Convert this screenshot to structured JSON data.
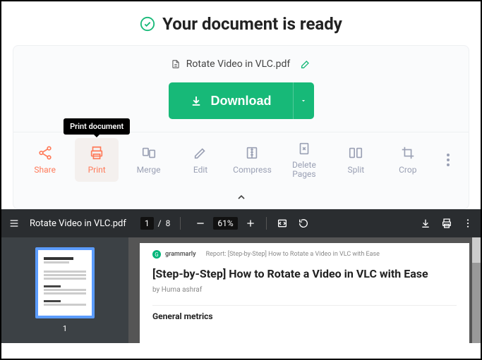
{
  "header": {
    "title": "Your document is ready"
  },
  "file": {
    "name": "Rotate Video in VLC.pdf"
  },
  "download": {
    "label": "Download"
  },
  "tooltip": {
    "print": "Print document"
  },
  "actions": {
    "share": "Share",
    "print": "Print",
    "merge": "Merge",
    "edit": "Edit",
    "compress": "Compress",
    "delete_pages": "Delete\nPages",
    "split": "Split",
    "crop": "Crop"
  },
  "viewer": {
    "title": "Rotate Video in VLC.pdf",
    "page_current": "1",
    "page_sep": "/",
    "page_total": "8",
    "zoom_pct": "61%",
    "thumb_label": "1"
  },
  "doc": {
    "brand": "grammarly",
    "report_line": "Report: [Step-by-Step] How to Rotate a Video in VLC with Ease",
    "title": "[Step-by-Step] How to Rotate a Video in VLC with Ease",
    "author": "by Huma ashraf",
    "section1": "General metrics"
  }
}
